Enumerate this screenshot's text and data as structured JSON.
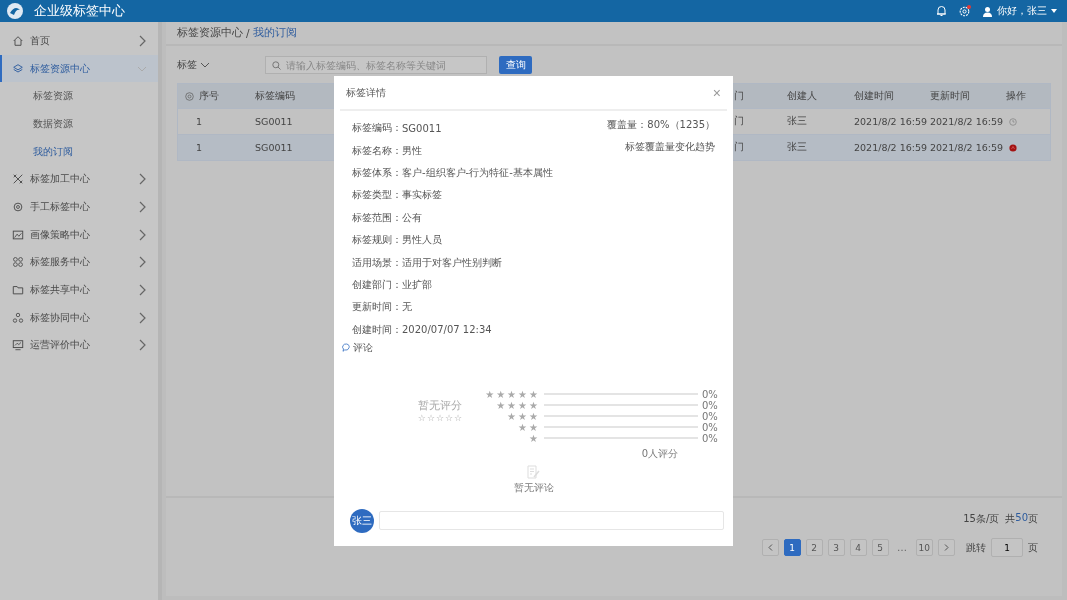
{
  "header": {
    "title": "企业级标签中心",
    "greeting": "你好，张三",
    "settings_badge": true
  },
  "sidebar": {
    "items": [
      {
        "label": "首页",
        "expanded": false,
        "selected": false
      },
      {
        "label": "标签资源中心",
        "expanded": true,
        "selected": true,
        "children": [
          {
            "label": "标签资源",
            "selected": false
          },
          {
            "label": "数据资源",
            "selected": false
          },
          {
            "label": "我的订阅",
            "selected": true
          }
        ]
      },
      {
        "label": "标签加工中心",
        "expanded": false,
        "selected": false
      },
      {
        "label": "手工标签中心",
        "expanded": false,
        "selected": false
      },
      {
        "label": "画像策略中心",
        "expanded": false,
        "selected": false
      },
      {
        "label": "标签服务中心",
        "expanded": false,
        "selected": false
      },
      {
        "label": "标签共享中心",
        "expanded": false,
        "selected": false
      },
      {
        "label": "标签协同中心",
        "expanded": false,
        "selected": false
      },
      {
        "label": "运营评价中心",
        "expanded": false,
        "selected": false
      }
    ]
  },
  "breadcrumb": [
    "标签资源中心",
    "我的订阅"
  ],
  "breadcrumb_separator": "/",
  "filter": {
    "type": "标签",
    "placeholder": "请输入标签编码、标签名称等关键词",
    "button": "查询"
  },
  "table": {
    "columns": [
      "序号",
      "标签编码",
      "门",
      "创建人",
      "创建时间",
      "更新时间",
      "操作"
    ],
    "rows": [
      {
        "selected": false,
        "kind": "clock",
        "cells": [
          "1",
          "SG0011",
          "门",
          "张三",
          "2021/8/2 16:59",
          "2021/8/2 16:59"
        ]
      },
      {
        "selected": true,
        "kind": "alert",
        "cells": [
          "1",
          "SG0011",
          "门",
          "张三",
          "2021/8/2 16:59",
          "2021/8/2 16:59"
        ]
      }
    ]
  },
  "pagination": {
    "per_page": "15条/页",
    "total_prefix": "共",
    "total_count": "50",
    "total_suffix": "页",
    "pages": [
      {
        "label": "1",
        "selected": true
      },
      {
        "label": "2",
        "selected": false
      },
      {
        "label": "3",
        "selected": false
      },
      {
        "label": "4",
        "selected": false
      },
      {
        "label": "5",
        "selected": false
      },
      {
        "label": "10",
        "selected": false
      }
    ],
    "ellipsis": "…",
    "jump_label": "跳转",
    "jump_value": "1",
    "jump_suffix": "页"
  },
  "dialog": {
    "title": "标签详情",
    "close": "×",
    "fields": [
      {
        "label": "标签编码：",
        "value": "SG0011"
      },
      {
        "label": "标签名称：",
        "value": "男性"
      },
      {
        "label": "标签体系：",
        "value": "客户-组织客户-行为特征-基本属性"
      },
      {
        "label": "标签类型：",
        "value": "事实标签"
      },
      {
        "label": "标签范围：",
        "value": "公有"
      },
      {
        "label": "标签规则：",
        "value": "男性人员"
      },
      {
        "label": "适用场景：",
        "value": "适用于对客户性别判断"
      },
      {
        "label": "创建部门：",
        "value": "业扩部"
      },
      {
        "label": "更新时间：",
        "value": "无"
      },
      {
        "label": "创建时间：",
        "value": "2020/07/07  12:34"
      }
    ],
    "coverage": "覆盖量：80%（1235）",
    "trend": "标签覆盖量变化趋势",
    "comments_title": "评论",
    "rating": {
      "title": "暂无评分",
      "stars": 0,
      "distribution": [
        {
          "stars_label": "★★★★★",
          "percent": "0%"
        },
        {
          "stars_label": "★★★★",
          "percent": "0%"
        },
        {
          "stars_label": "★★★",
          "percent": "0%"
        },
        {
          "stars_label": "★★",
          "percent": "0%"
        },
        {
          "stars_label": "★",
          "percent": "0%"
        }
      ],
      "count": "0人评分"
    },
    "empty": "暂无评论",
    "avatar": "张三"
  }
}
